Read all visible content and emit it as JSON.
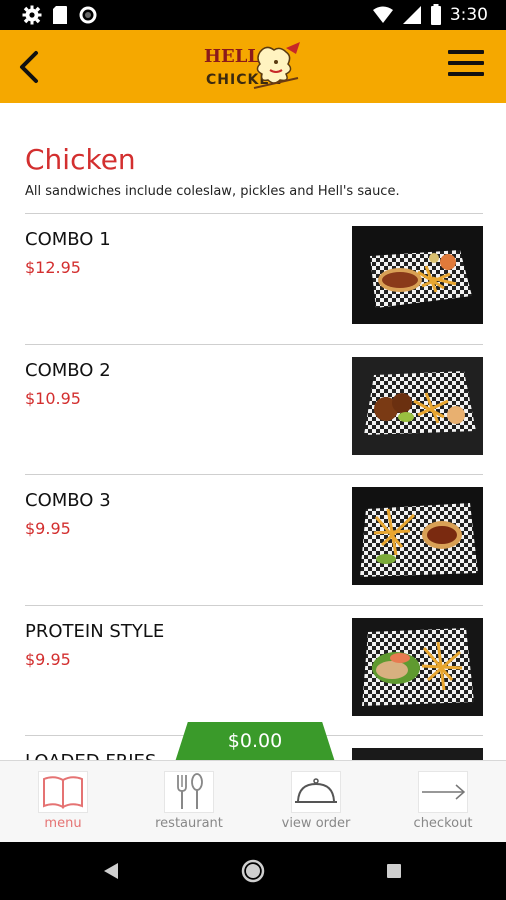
{
  "status_bar": {
    "time": "3:30",
    "icons": [
      "settings-icon",
      "sd-card-icon",
      "circle-icon",
      "wifi-icon",
      "signal-icon",
      "battery-icon"
    ]
  },
  "app_bar": {
    "logo_text": "HELL'S CHICKEN",
    "icons": [
      "back-arrow-icon",
      "hamburger-menu-icon"
    ]
  },
  "category": {
    "title": "Chicken",
    "description": "All sandwiches include coleslaw, pickles and Hell's sauce."
  },
  "items": [
    {
      "name": "COMBO 1",
      "price": "$12.95"
    },
    {
      "name": "COMBO 2",
      "price": "$10.95"
    },
    {
      "name": "COMBO 3",
      "price": "$9.95"
    },
    {
      "name": "PROTEIN STYLE",
      "price": "$9.95"
    },
    {
      "name": "LOADED FRIES",
      "price": ""
    }
  ],
  "cart": {
    "total": "$0.00"
  },
  "bottom_nav": {
    "items": [
      {
        "label": "menu",
        "icon": "book-icon",
        "active": true
      },
      {
        "label": "restaurant",
        "icon": "fork-knife-icon",
        "active": false
      },
      {
        "label": "view order",
        "icon": "cloche-icon",
        "active": false
      },
      {
        "label": "checkout",
        "icon": "arrow-right-icon",
        "active": false
      }
    ]
  },
  "colors": {
    "app_bar": "#f5a800",
    "accent_red": "#d32f2f",
    "cart_green": "#3a9a2a"
  }
}
